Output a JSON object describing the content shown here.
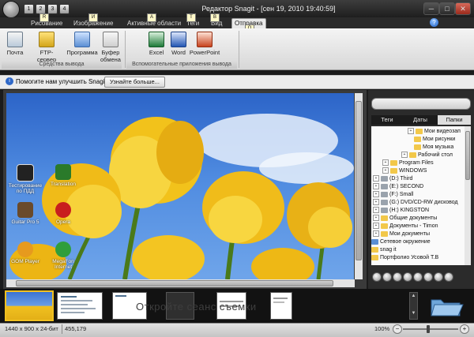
{
  "window": {
    "title": "Редактор Snagit - [сен 19, 2010 19:40:59]",
    "quick_access": [
      "1",
      "2",
      "3",
      "4"
    ],
    "minimize": "─",
    "maximize": "□",
    "close": "✕"
  },
  "ribbon": {
    "tabs": [
      {
        "label": "Рисование",
        "key": "R"
      },
      {
        "label": "Изображение",
        "key": "И"
      },
      {
        "label": "Активные области",
        "key": "A"
      },
      {
        "label": "Теги",
        "key": "Т"
      },
      {
        "label": "Вид",
        "key": "B"
      },
      {
        "label": "Отправка",
        "key": "O"
      }
    ],
    "active_tab": "Отправка",
    "output_buttons": [
      {
        "label": "Почта",
        "key": "Y"
      },
      {
        "label": "FTP-сервер",
        "key": "P"
      },
      {
        "label": "Программа",
        "key": "A"
      },
      {
        "label": "Буфер обмена",
        "key": "C"
      }
    ],
    "output_group": "Средства вывода",
    "app_buttons": [
      {
        "label": "Excel",
        "key": "E",
        "color": "#1e7a38"
      },
      {
        "label": "Word",
        "key": "W",
        "color": "#2457b3"
      },
      {
        "label": "PowerPoint",
        "key": "T",
        "color": "#c8431d"
      }
    ],
    "app_group": "Вспомогательные приложения вывода"
  },
  "infobar": {
    "text": "Помогите нам улучшить Snagit",
    "button": "Узнайте больше..."
  },
  "desktop_icons": [
    {
      "label": "Тестирование по ПДД",
      "color": "#222222"
    },
    {
      "label": "Translation",
      "color": "#2a7a2a"
    },
    {
      "label": "Guitar Pro 5",
      "color": "#6a4a2a"
    },
    {
      "label": "Opera",
      "color": "#c81e1e"
    },
    {
      "label": "GOM Player",
      "color": "#e69a1e"
    },
    {
      "label": "MegaFon Internet",
      "color": "#2f9e3c"
    }
  ],
  "side_panel": {
    "tabs": [
      "Теги",
      "Даты",
      "Папки"
    ],
    "active_tab": "Папки",
    "tree": [
      {
        "label": "Мои видеозап",
        "indent": 46,
        "pm": "+",
        "icon": "folder"
      },
      {
        "label": "Мои рисунки",
        "indent": 54,
        "pm": "",
        "icon": "folder"
      },
      {
        "label": "Моя музыка",
        "indent": 54,
        "pm": "",
        "icon": "folder"
      },
      {
        "label": "Рабочий стол",
        "indent": 38,
        "pm": "+",
        "icon": "folder"
      },
      {
        "label": "Program Files",
        "indent": 14,
        "pm": "+",
        "icon": "folder"
      },
      {
        "label": "WINDOWS",
        "indent": 14,
        "pm": "+",
        "icon": "folder"
      },
      {
        "label": "(D:) Third",
        "indent": 2,
        "pm": "+",
        "icon": "drive"
      },
      {
        "label": "(E:) SECOND",
        "indent": 2,
        "pm": "+",
        "icon": "drive"
      },
      {
        "label": "(F:) Small",
        "indent": 2,
        "pm": "+",
        "icon": "drive"
      },
      {
        "label": "(G:) DVD/CD-RW дисковод",
        "indent": 2,
        "pm": "+",
        "icon": "drive"
      },
      {
        "label": "(H:) KINGSTON",
        "indent": 2,
        "pm": "+",
        "icon": "drive"
      },
      {
        "label": "Общие документы",
        "indent": 2,
        "pm": "+",
        "icon": "folder"
      },
      {
        "label": "Документы - Timon",
        "indent": 2,
        "pm": "+",
        "icon": "folder"
      },
      {
        "label": "Мои документы",
        "indent": 2,
        "pm": "+",
        "icon": "folder"
      },
      {
        "label": "Сетевое окружение",
        "indent": 0,
        "pm": "",
        "icon": "network"
      },
      {
        "label": "snag it",
        "indent": 0,
        "pm": "",
        "icon": "folder"
      },
      {
        "label": "Портфолио Усовой Т.В",
        "indent": 0,
        "pm": "",
        "icon": "folder"
      }
    ]
  },
  "tray": {
    "hint": "Откройте сеанс съемки"
  },
  "status": {
    "dimensions": "1440 x 900 x 24-бит",
    "coords": "455,179",
    "zoom": "100%"
  }
}
